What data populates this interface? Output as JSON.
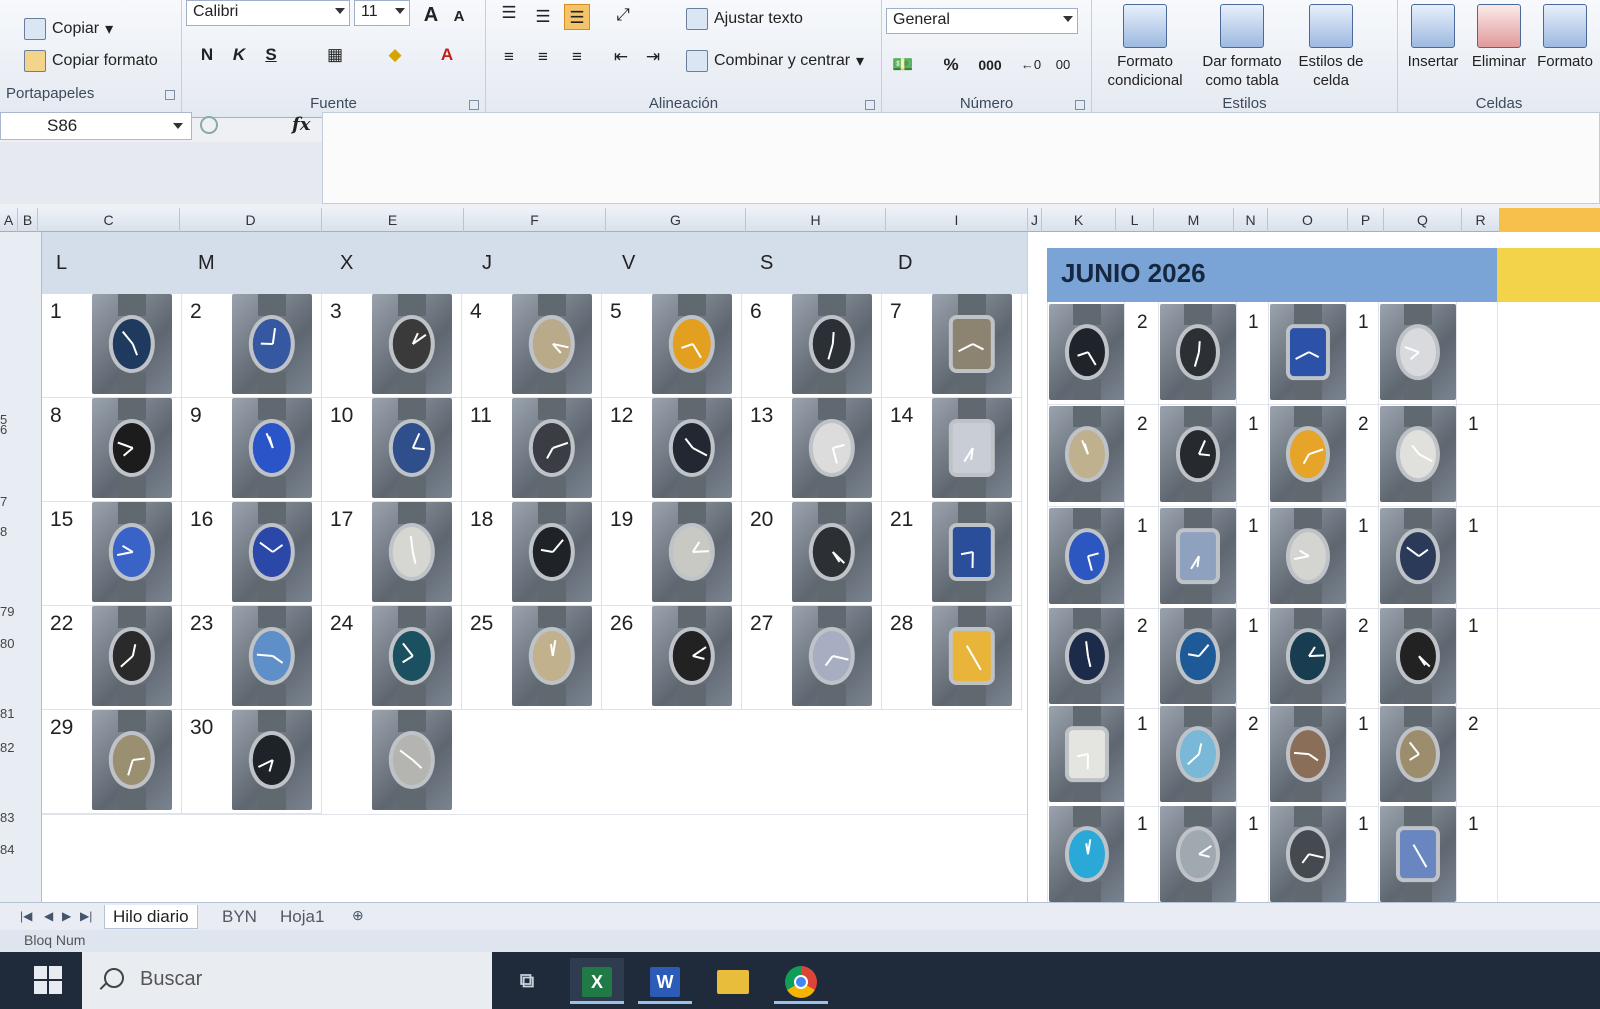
{
  "ribbon": {
    "clipboard": {
      "copy": "Copiar",
      "format_painter": "Copiar formato",
      "group": "Portapapeles"
    },
    "font": {
      "family": "Calibri",
      "size": "11",
      "bold": "N",
      "italic": "K",
      "strike": "S",
      "grow": "A",
      "shrink": "A",
      "group": "Fuente"
    },
    "alignment": {
      "wrap": "Ajustar texto",
      "merge": "Combinar y centrar",
      "group": "Alineación"
    },
    "number": {
      "format": "General",
      "percent": "%",
      "thousands": "000",
      "group": "Número"
    },
    "styles": {
      "conditional": "Formato condicional",
      "as_table": "Dar formato como tabla",
      "cell_styles": "Estilos de celda",
      "group": "Estilos"
    },
    "cells": {
      "insert": "Insertar",
      "delete": "Eliminar",
      "format": "Formato",
      "group": "Celdas"
    }
  },
  "formula_bar": {
    "name_box": "S86",
    "fx": "fx",
    "formula": ""
  },
  "columns": [
    "A",
    "B",
    "C",
    "D",
    "E",
    "F",
    "G",
    "H",
    "I",
    "J",
    "K",
    "L",
    "M",
    "N",
    "O",
    "P",
    "Q",
    "R"
  ],
  "rows": [
    "5",
    "6",
    "7",
    "8",
    "79",
    "80",
    "81",
    "82",
    "83",
    "84"
  ],
  "calendar": {
    "day_headers": [
      "L",
      "M",
      "X",
      "J",
      "V",
      "S",
      "D"
    ],
    "days": [
      "1",
      "2",
      "3",
      "4",
      "5",
      "6",
      "7",
      "8",
      "9",
      "10",
      "11",
      "12",
      "13",
      "14",
      "15",
      "16",
      "17",
      "18",
      "19",
      "20",
      "21",
      "22",
      "23",
      "24",
      "25",
      "26",
      "27",
      "28",
      "29",
      "30"
    ]
  },
  "stats": {
    "title": "JUNIO 2026",
    "counts": [
      [
        "2",
        "1",
        "1",
        ""
      ],
      [
        "2",
        "1",
        "2",
        "1"
      ],
      [
        "1",
        "1",
        "1",
        "1"
      ],
      [
        "2",
        "1",
        "2",
        "1"
      ],
      [
        "1",
        "2",
        "1",
        "2"
      ],
      [
        "1",
        "1",
        "1",
        "1"
      ]
    ]
  },
  "sheet_tabs": [
    "Hilo diario",
    "BYN",
    "Hoja1"
  ],
  "status": {
    "mode": "Bloq Num"
  },
  "taskbar": {
    "search_placeholder": "Buscar",
    "apps": [
      "task-view",
      "excel",
      "word",
      "file-explorer",
      "chrome"
    ]
  },
  "watch_colors": {
    "calendar": [
      "#1e3a5f",
      "#3558a0",
      "#3a3a3a",
      "#b9ab8a",
      "#e3a020",
      "#2b2f36",
      "#8c8470",
      "#1c1c1c",
      "#2a55c8",
      "#2e4f8c",
      "#3a3e44",
      "#222831",
      "#dcdcdc",
      "#c9ced6",
      "#3a63c8",
      "#2b47a8",
      "#d7d7d2",
      "#1f2328",
      "#c9c9c4",
      "#2c3034",
      "#2b4e9a",
      "#2a2a2a",
      "#5f8fc8",
      "#1a5060",
      "#c1b18c",
      "#222",
      "#a8aec2",
      "#e8b43a",
      "#9b8f72",
      "#1d2328",
      "#b4b4b0"
    ],
    "stats": [
      "#1f242a",
      "#2c3035",
      "#2c51a8",
      "#d8dadd",
      "#bfb08e",
      "#262a2e",
      "#e6a428",
      "#e0e0dd",
      "#2c57c0",
      "#8ea2c0",
      "#d4d4d0",
      "#2c3a5a",
      "#1d2b4a",
      "#1f5a98",
      "#183c50",
      "#222",
      "#e4e4e0",
      "#7ab8d8",
      "#8a6e58",
      "#9c8e6c",
      "#2aa8d8",
      "#a0a8b0",
      "#444a50",
      "#6a86c0"
    ]
  }
}
